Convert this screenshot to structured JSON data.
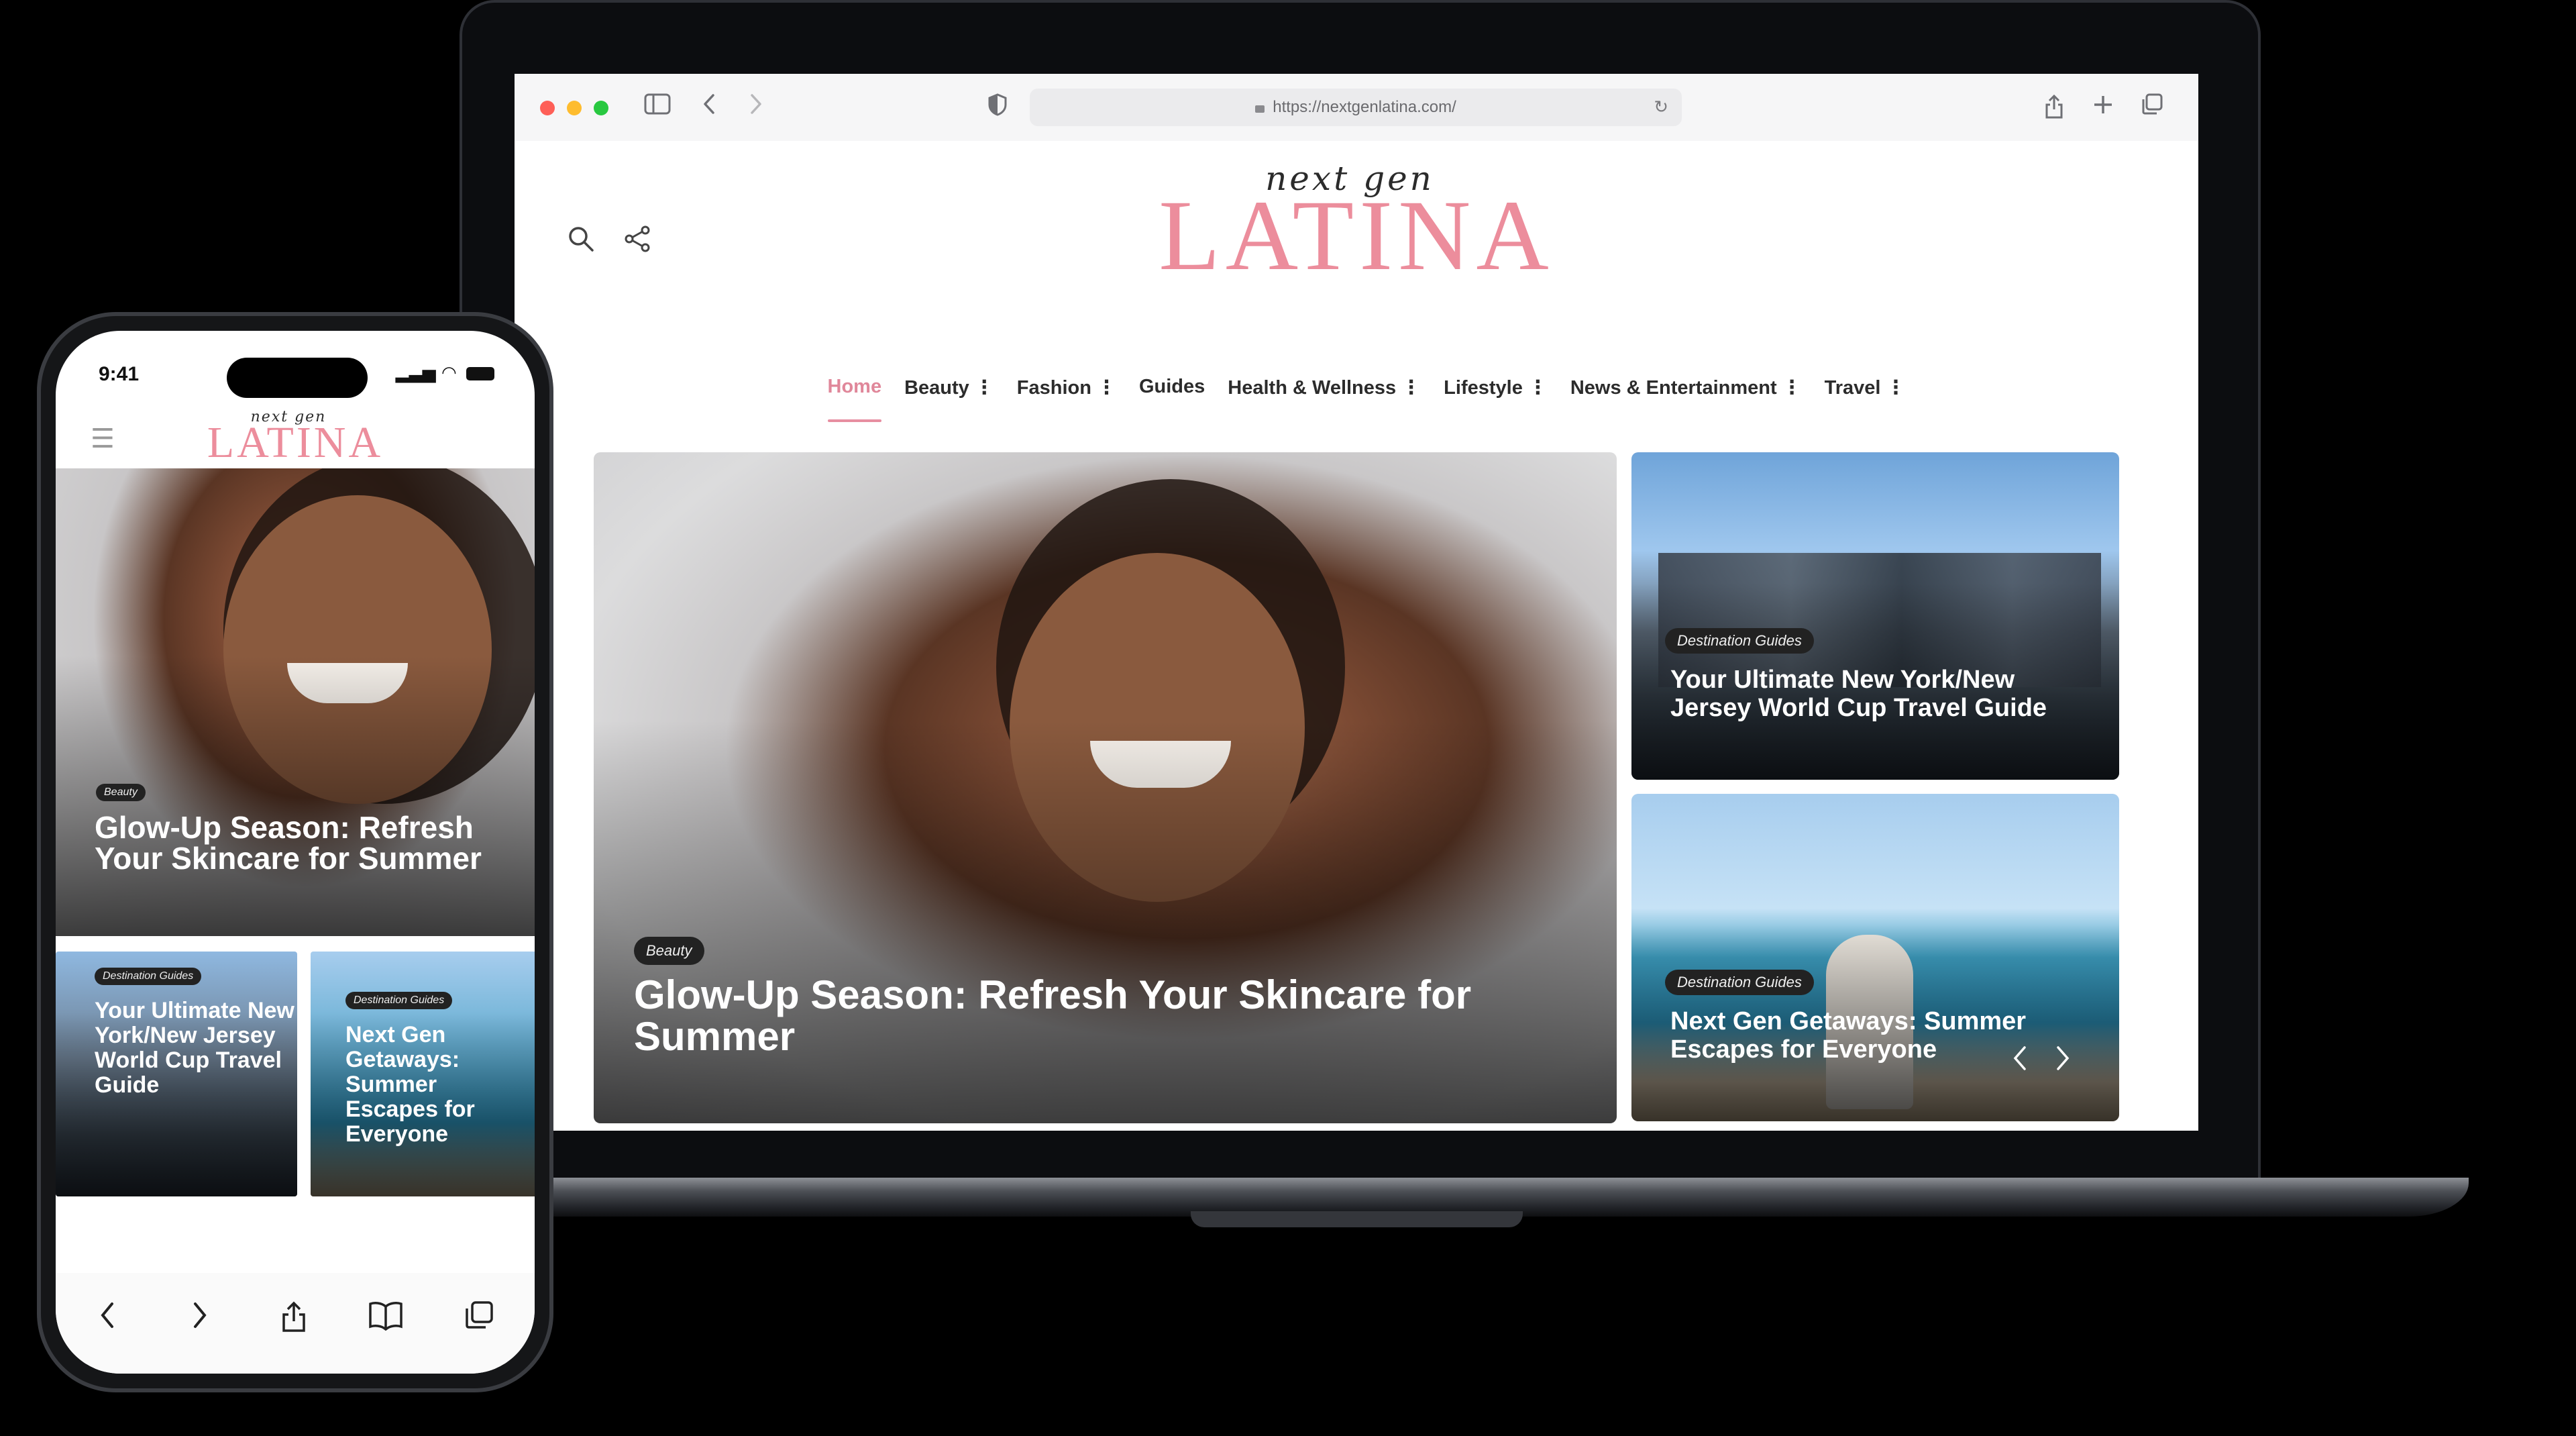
{
  "browser": {
    "url": "https://nextgenlatina.com/"
  },
  "site": {
    "logo_script": "next gen",
    "logo_main": "LATINA",
    "brand_color": "#ec8d9c",
    "accent_color": "#e0879a"
  },
  "nav": {
    "items": [
      {
        "label": "Home",
        "active": true,
        "has_menu": false
      },
      {
        "label": "Beauty",
        "has_menu": true
      },
      {
        "label": "Fashion",
        "has_menu": true
      },
      {
        "label": "Guides",
        "has_menu": false
      },
      {
        "label": "Health & Wellness",
        "has_menu": true
      },
      {
        "label": "Lifestyle",
        "has_menu": true
      },
      {
        "label": "News & Entertainment",
        "has_menu": true
      },
      {
        "label": "Travel",
        "has_menu": true
      }
    ],
    "menu_glyph": "⋮"
  },
  "hero": {
    "category": "Beauty",
    "title": "Glow-Up Season: Refresh Your Skincare for Summer"
  },
  "side_cards": [
    {
      "category": "Destination Guides",
      "title": "Your Ultimate New York/New Jersey World Cup Travel Guide"
    },
    {
      "category": "Destination Guides",
      "title": "Next Gen Getaways: Summer Escapes for Everyone"
    }
  ],
  "phone": {
    "time": "9:41",
    "hero_category": "Beauty",
    "hero_title": "Glow-Up Season: Refresh Your Skincare for Summer",
    "cards": [
      {
        "category": "Destination Guides",
        "title": "Your Ultimate New York/New Jersey World Cup Travel Guide"
      },
      {
        "category": "Destination Guides",
        "title": "Next Gen Getaways: Summer Escapes for Everyone"
      }
    ]
  }
}
